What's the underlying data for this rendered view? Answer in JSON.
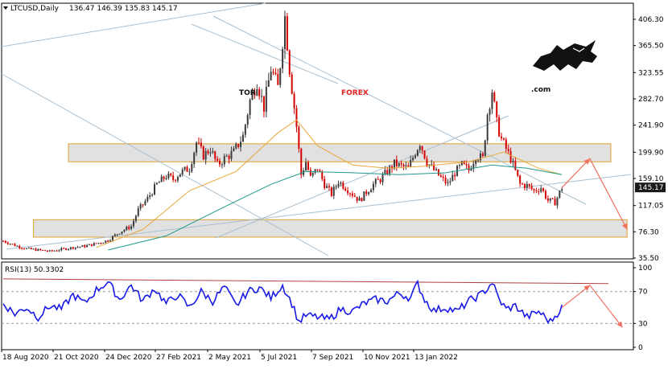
{
  "header": {
    "symbol": "LTCUSD,Daily",
    "ohlc": "136.47 146.39 135.83 145.17"
  },
  "watermark": {
    "tor": "TOR",
    "forex": "FOREX",
    "com": ".com",
    "logo_icon": "bull-icon"
  },
  "rsi_header": "RSI(13) 50.3302",
  "colors": {
    "bull_candle": "#3a3a3a",
    "bear_candle": "#d40000",
    "ma_fast": "#e8a93a",
    "ma_slow": "#1e9a8a",
    "trendline": "#a9bfd0",
    "zone_fill": "#dcdcdc",
    "zone_border": "#e0a030",
    "forecast_arrow": "#f07060",
    "rsi_line": "#1a1ae6",
    "rsi_trend": "#b04040",
    "price_tag_bg": "#1a1a1a",
    "brand_red": "#e21f1f"
  },
  "chart_data": [
    {
      "type": "candlestick",
      "title": "LTCUSD,Daily",
      "y_ticks": [
        "406.30",
        "365.50",
        "323.55",
        "282.70",
        "241.90",
        "199.90",
        "159.10",
        "117.05",
        "76.30",
        "35.50"
      ],
      "y_tick_values": [
        406.3,
        365.5,
        323.55,
        282.7,
        241.9,
        199.9,
        159.1,
        117.05,
        76.3,
        35.5
      ],
      "ylim": [
        35.5,
        406.3
      ],
      "x_ticks": [
        "18 Aug 2020",
        "21 Oct 2020",
        "24 Dec 2020",
        "27 Feb 2021",
        "2 May 2021",
        "5 Jul 2021",
        "7 Sep 2021",
        "10 Nov 2021",
        "13 Jan 2022"
      ],
      "last_price": "145.17",
      "price_path": [
        [
          0,
          62
        ],
        [
          6,
          54
        ],
        [
          10,
          50
        ],
        [
          15,
          48
        ],
        [
          20,
          46
        ],
        [
          25,
          49
        ],
        [
          30,
          52
        ],
        [
          35,
          54
        ],
        [
          40,
          58
        ],
        [
          45,
          63
        ],
        [
          50,
          76
        ],
        [
          55,
          85
        ],
        [
          58,
          110
        ],
        [
          62,
          128
        ],
        [
          66,
          150
        ],
        [
          70,
          163
        ],
        [
          73,
          158
        ],
        [
          76,
          168
        ],
        [
          80,
          175
        ],
        [
          83,
          215
        ],
        [
          86,
          195
        ],
        [
          89,
          205
        ],
        [
          92,
          180
        ],
        [
          95,
          190
        ],
        [
          99,
          200
        ],
        [
          103,
          225
        ],
        [
          106,
          280
        ],
        [
          109,
          310
        ],
        [
          112,
          270
        ],
        [
          115,
          330
        ],
        [
          118,
          300
        ],
        [
          121,
          410
        ],
        [
          123,
          330
        ],
        [
          126,
          240
        ],
        [
          128,
          165
        ],
        [
          130,
          185
        ],
        [
          132,
          160
        ],
        [
          135,
          175
        ],
        [
          138,
          150
        ],
        [
          141,
          135
        ],
        [
          144,
          155
        ],
        [
          147,
          145
        ],
        [
          150,
          135
        ],
        [
          153,
          125
        ],
        [
          156,
          138
        ],
        [
          159,
          150
        ],
        [
          162,
          158
        ],
        [
          165,
          170
        ],
        [
          168,
          182
        ],
        [
          171,
          178
        ],
        [
          174,
          175
        ],
        [
          177,
          200
        ],
        [
          179,
          215
        ],
        [
          182,
          185
        ],
        [
          185,
          172
        ],
        [
          188,
          160
        ],
        [
          191,
          150
        ],
        [
          194,
          168
        ],
        [
          197,
          180
        ],
        [
          200,
          172
        ],
        [
          203,
          195
        ],
        [
          206,
          190
        ],
        [
          208,
          260
        ],
        [
          210,
          296
        ],
        [
          212,
          245
        ],
        [
          214,
          220
        ],
        [
          216,
          205
        ],
        [
          218,
          190
        ],
        [
          220,
          170
        ],
        [
          222,
          150
        ],
        [
          225,
          148
        ],
        [
          228,
          140
        ],
        [
          231,
          145
        ],
        [
          234,
          125
        ],
        [
          237,
          122
        ],
        [
          240,
          145
        ]
      ],
      "moving_averages": [
        {
          "path": [
            [
              40,
              52
            ],
            [
              60,
              80
            ],
            [
              80,
              140
            ],
            [
              100,
              170
            ],
            [
              118,
              230
            ],
            [
              126,
              250
            ],
            [
              135,
              210
            ],
            [
              150,
              180
            ],
            [
              165,
              175
            ],
            [
              180,
              178
            ],
            [
              200,
              185
            ],
            [
              215,
              200
            ],
            [
              230,
              175
            ],
            [
              240,
              165
            ]
          ]
        },
        {
          "path": [
            [
              45,
              48
            ],
            [
              70,
              70
            ],
            [
              95,
              115
            ],
            [
              115,
              150
            ],
            [
              130,
              170
            ],
            [
              150,
              168
            ],
            [
              170,
              165
            ],
            [
              190,
              168
            ],
            [
              210,
              180
            ],
            [
              225,
              175
            ],
            [
              240,
              165
            ]
          ]
        }
      ],
      "support_resistance_zones": [
        {
          "low": 185,
          "high": 213
        },
        {
          "low": 68,
          "high": 95
        }
      ],
      "forecast_path": [
        [
          240,
          145
        ],
        [
          252,
          190
        ],
        [
          268,
          80
        ]
      ]
    },
    {
      "type": "line",
      "title": "RSI(13) 50.3302",
      "y_ticks": [
        "100",
        "70",
        "30",
        "0"
      ],
      "y_tick_values": [
        100,
        70,
        30,
        0
      ],
      "ylim": [
        0,
        100
      ],
      "levels": [
        70,
        30
      ],
      "last_value": 50.3302,
      "rsi_path": [
        [
          0,
          55
        ],
        [
          5,
          42
        ],
        [
          10,
          50
        ],
        [
          15,
          38
        ],
        [
          20,
          52
        ],
        [
          25,
          48
        ],
        [
          30,
          66
        ],
        [
          35,
          55
        ],
        [
          40,
          72
        ],
        [
          45,
          82
        ],
        [
          50,
          60
        ],
        [
          55,
          78
        ],
        [
          60,
          58
        ],
        [
          65,
          74
        ],
        [
          70,
          55
        ],
        [
          75,
          66
        ],
        [
          80,
          50
        ],
        [
          85,
          70
        ],
        [
          90,
          58
        ],
        [
          95,
          76
        ],
        [
          100,
          52
        ],
        [
          105,
          70
        ],
        [
          110,
          75
        ],
        [
          115,
          62
        ],
        [
          120,
          78
        ],
        [
          124,
          55
        ],
        [
          127,
          32
        ],
        [
          130,
          40
        ],
        [
          135,
          38
        ],
        [
          140,
          35
        ],
        [
          145,
          48
        ],
        [
          150,
          45
        ],
        [
          155,
          55
        ],
        [
          160,
          60
        ],
        [
          165,
          58
        ],
        [
          170,
          68
        ],
        [
          175,
          62
        ],
        [
          178,
          80
        ],
        [
          181,
          60
        ],
        [
          185,
          46
        ],
        [
          190,
          50
        ],
        [
          195,
          45
        ],
        [
          200,
          58
        ],
        [
          205,
          66
        ],
        [
          208,
          74
        ],
        [
          210,
          82
        ],
        [
          213,
          60
        ],
        [
          216,
          48
        ],
        [
          220,
          52
        ],
        [
          225,
          38
        ],
        [
          230,
          45
        ],
        [
          235,
          32
        ],
        [
          240,
          50
        ]
      ],
      "trend_line": [
        [
          0,
          86
        ],
        [
          260,
          80
        ]
      ],
      "forecast_path": [
        [
          240,
          50
        ],
        [
          252,
          78
        ],
        [
          266,
          25
        ]
      ]
    }
  ]
}
